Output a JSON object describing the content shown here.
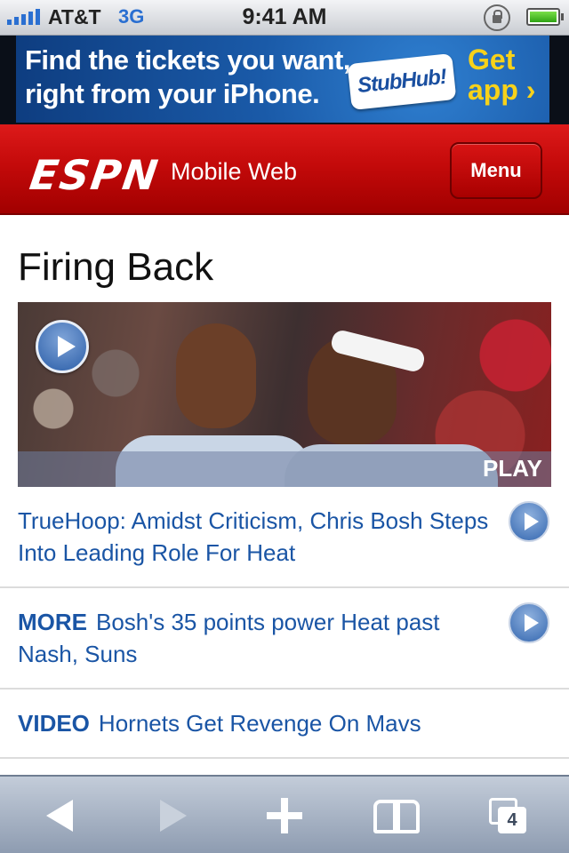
{
  "status_bar": {
    "carrier": "AT&T",
    "network": "3G",
    "time": "9:41 AM",
    "icons": [
      "signal-icon",
      "rotation-lock-icon",
      "battery-icon"
    ]
  },
  "ad": {
    "line1": "Find the tickets you want,",
    "line2": "right from your iPhone.",
    "brand": "StubHub!",
    "cta_line1": "Get",
    "cta_line2": "app ›"
  },
  "header": {
    "logo": "ESPN",
    "subtitle": "Mobile Web",
    "menu_label": "Menu"
  },
  "main": {
    "headline": "Firing Back",
    "play_label": "PLAY",
    "stories": [
      {
        "tag": "",
        "text": "TrueHoop: Amidst Criticism, Chris Bosh Steps Into Leading Role For Heat",
        "has_play": true
      },
      {
        "tag": "MORE",
        "text": "Bosh's 35 points power Heat past Nash, Suns",
        "has_play": true
      },
      {
        "tag": "VIDEO",
        "text": "Hornets Get Revenge On Mavs",
        "has_play": false
      }
    ]
  },
  "toolbar": {
    "tab_count": "4",
    "icons": [
      "back-arrow-icon",
      "forward-arrow-icon",
      "add-bookmark-icon",
      "bookmarks-icon",
      "pages-icon"
    ]
  },
  "colors": {
    "espn_red": "#c40a0a",
    "link_blue": "#1a55a5",
    "stubhub_yellow": "#f7d21a"
  }
}
